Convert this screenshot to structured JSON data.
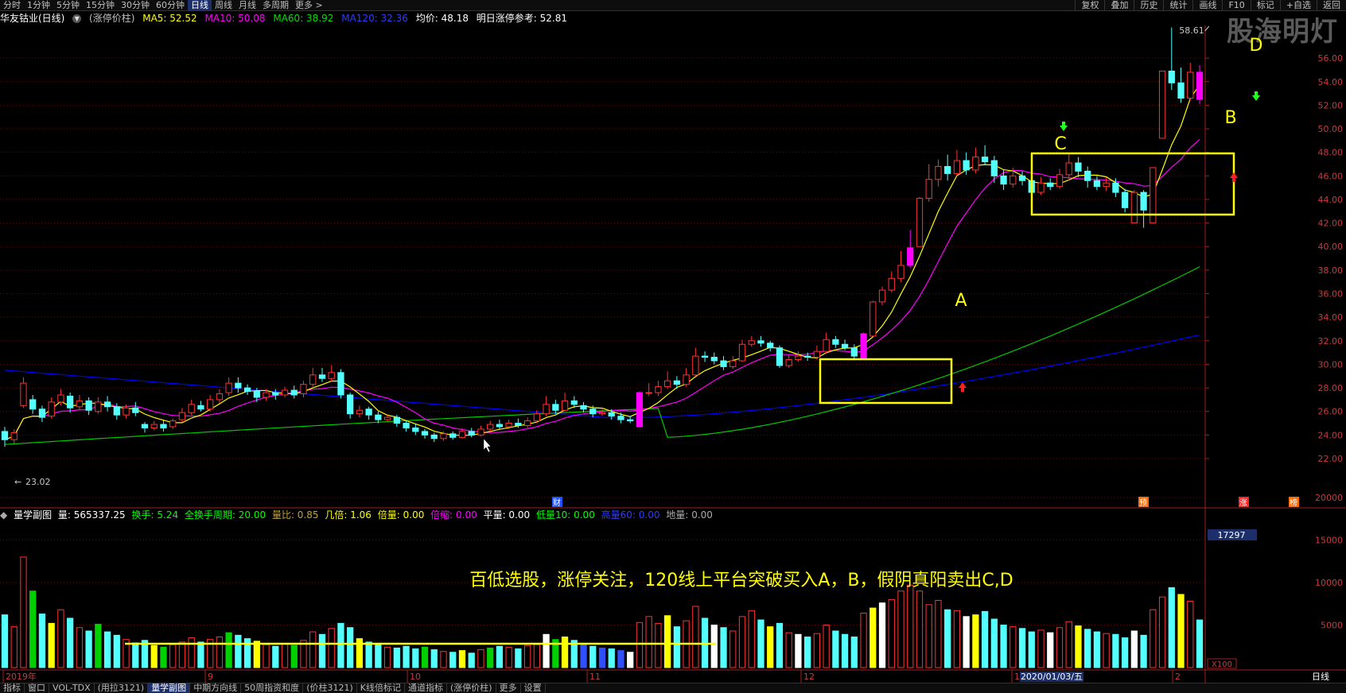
{
  "top_bar": {
    "periods": [
      "分时",
      "1分钟",
      "5分钟",
      "15分钟",
      "30分钟",
      "60分钟",
      "日线",
      "周线",
      "月线",
      "多周期",
      "更多 >"
    ],
    "active_period": "日线",
    "right_buttons": [
      "复权",
      "叠加",
      "历史",
      "统计",
      "画线",
      "F10",
      "标记",
      "+自选",
      "返回"
    ]
  },
  "stock": {
    "name": "华友钴业(日线)",
    "indicator": "(涨停价柱)",
    "ma5": "MA5: 52.52",
    "ma10": "MA10: 50.08",
    "ma60": "MA60: 38.92",
    "ma120": "MA120: 32.36",
    "avg_price": "均价: 48.18",
    "limit_ref": "明日涨停参考: 52.81"
  },
  "watermark": "股海明灯",
  "price_axis": {
    "ticks": [
      "56.00",
      "54.00",
      "52.00",
      "50.00",
      "48.00",
      "46.00",
      "44.00",
      "42.00",
      "40.00",
      "38.00",
      "36.00",
      "34.00",
      "32.00",
      "30.00",
      "28.00",
      "26.00",
      "24.00",
      "22.00"
    ],
    "high_label": "58.61",
    "low_label": "23.02"
  },
  "annotations": {
    "A": "A",
    "B": "B",
    "C": "C",
    "D": "D",
    "caption": "百低选股，涨停关注，120线上平台突破买入A，B，假阴真阳卖出C,D",
    "markers": [
      "财",
      "预",
      "涨",
      "榜"
    ]
  },
  "sub_panel": {
    "name": "量学副图",
    "volume": "量: 565337.25",
    "turnover": "换手: 5.24",
    "full_turn": "全换手周期: 20.00",
    "vol_ratio": "量比: 0.85",
    "jibei": "几倍: 1.06",
    "beiliang": "倍量: 0.00",
    "beisuo": "倍缩: 0.00",
    "pingliang": "平量: 0.00",
    "dibei": "低量10: 0.00",
    "gaoliang": "高量60: 0.00",
    "diliang": "地量: 0.00",
    "axis_ticks": [
      "20000",
      "15000",
      "10000",
      "5000"
    ],
    "current_value": "17297",
    "unit": "X100"
  },
  "date_axis": {
    "labels": [
      "2019年",
      "9",
      "10",
      "11",
      "12",
      "1",
      "2"
    ],
    "cursor_date": "2020/01/03/五",
    "right_label": "日线"
  },
  "bottom_tabs": [
    "指标",
    "窗口",
    "VOL-TDX",
    "(用拉3121)",
    "量学副图",
    "中期方向线",
    "50周指资和度",
    "(价柱3121)",
    "K线倍标记",
    "通道指标",
    "(涨停价柱)",
    "更多",
    "设置"
  ],
  "bottom_active_tab": "量学副图",
  "colors": {
    "up": "#ff3232",
    "down": "#54ffff",
    "limit_up": "#ff00ff",
    "ma5": "#ffff00",
    "ma10": "#ff00ff",
    "ma60": "#00c800",
    "ma120": "#0000ff",
    "box": "#ffff00"
  }
}
